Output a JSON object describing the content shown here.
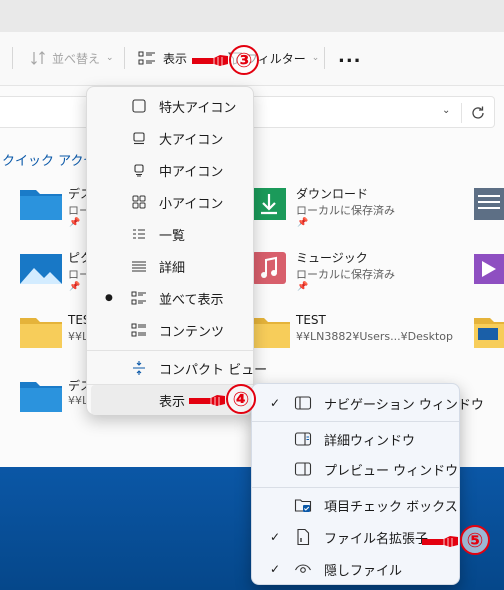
{
  "toolbar": {
    "sort_label": "並べ替え",
    "view_label": "表示",
    "filter_label": "フィルター",
    "more_label": "..."
  },
  "addressbar": {
    "refresh_icon": "refresh-icon"
  },
  "quick_access": {
    "title": "クイック アクセス",
    "items": [
      {
        "name": "デス",
        "sub": "ローカ",
        "pinned": true,
        "icon": "desktop-folder-icon"
      },
      {
        "name": "ダウンロード",
        "sub": "ローカルに保存済み",
        "pinned": true,
        "icon": "downloads-folder-icon"
      },
      {
        "name": "ピク",
        "sub": "ローカ",
        "pinned": true,
        "icon": "pictures-folder-icon"
      },
      {
        "name": "ミュージック",
        "sub": "ローカルに保存済み",
        "pinned": true,
        "icon": "music-folder-icon"
      },
      {
        "name": "TES",
        "sub": "¥¥LN",
        "pinned": false,
        "icon": "folder-icon"
      },
      {
        "name": "TEST",
        "sub": "¥¥LN3882¥Users...¥Desktop",
        "pinned": false,
        "icon": "folder-icon"
      },
      {
        "name": "デス",
        "sub": "¥¥LN",
        "pinned": false,
        "icon": "desktop-folder-icon"
      }
    ]
  },
  "view_menu": {
    "items": [
      {
        "label": "特大アイコン",
        "icon": "extra-large-icons-icon"
      },
      {
        "label": "大アイコン",
        "icon": "large-icons-icon"
      },
      {
        "label": "中アイコン",
        "icon": "medium-icons-icon"
      },
      {
        "label": "小アイコン",
        "icon": "small-icons-icon"
      },
      {
        "label": "一覧",
        "icon": "list-icon"
      },
      {
        "label": "詳細",
        "icon": "details-icon"
      },
      {
        "label": "並べて表示",
        "icon": "tiles-icon",
        "selected": true
      },
      {
        "label": "コンテンツ",
        "icon": "content-icon"
      },
      {
        "label": "コンパクト ビュー",
        "icon": "compact-view-icon"
      },
      {
        "label": "表示",
        "icon": "",
        "submenu": true
      }
    ]
  },
  "show_submenu": {
    "items": [
      {
        "label": "ナビゲーション ウィンドウ",
        "checked": true,
        "icon": "navigation-pane-icon"
      },
      {
        "label": "詳細ウィンドウ",
        "checked": false,
        "icon": "details-pane-icon"
      },
      {
        "label": "プレビュー ウィンドウ",
        "checked": false,
        "icon": "preview-pane-icon"
      },
      {
        "label": "項目チェック ボックス",
        "checked": false,
        "icon": "item-checkbox-icon"
      },
      {
        "label": "ファイル名拡張子",
        "checked": true,
        "icon": "file-extension-icon"
      },
      {
        "label": "隠しファイル",
        "checked": true,
        "icon": "hidden-files-icon"
      }
    ]
  },
  "annotations": {
    "step3": "③",
    "step4": "④",
    "step5": "⑤"
  },
  "colors": {
    "annotation_red": "#e3000f",
    "accent_blue": "#0a58a8",
    "desktop_blue": "#0a4f94"
  }
}
